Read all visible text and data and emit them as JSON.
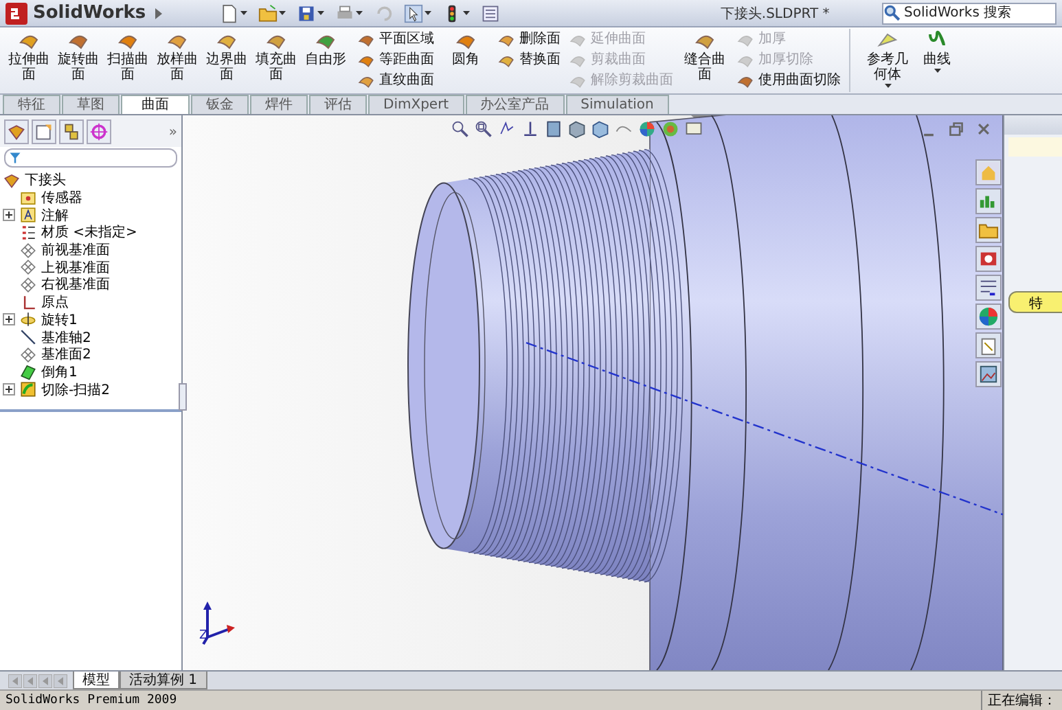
{
  "app": {
    "logo": "SolidWorks",
    "title": "下接头.SLDPRT *",
    "search": {
      "placeholder": "SolidWorks 搜索"
    }
  },
  "ribbon": [
    {
      "kind": "large",
      "items": [
        {
          "label": "拉伸曲面",
          "disabled": false
        },
        {
          "label": "旋转曲面",
          "disabled": false
        },
        {
          "label": "扫描曲面",
          "disabled": false
        },
        {
          "label": "放样曲面",
          "disabled": false
        },
        {
          "label": "边界曲面",
          "disabled": false
        },
        {
          "label": "填充曲面",
          "disabled": false
        },
        {
          "label": "自由形",
          "disabled": false
        }
      ]
    },
    {
      "kind": "column",
      "items": [
        {
          "label": "平面区域",
          "disabled": false
        },
        {
          "label": "等距曲面",
          "disabled": false
        },
        {
          "label": "直纹曲面",
          "disabled": false
        }
      ]
    },
    {
      "kind": "large",
      "items": [
        {
          "label": "圆角",
          "disabled": false
        }
      ]
    },
    {
      "kind": "column",
      "items": [
        {
          "label": "删除面",
          "disabled": false
        },
        {
          "label": "替换面",
          "disabled": false
        }
      ]
    },
    {
      "kind": "column",
      "items": [
        {
          "label": "延伸曲面",
          "disabled": true
        },
        {
          "label": "剪裁曲面",
          "disabled": true
        },
        {
          "label": "解除剪裁曲面",
          "disabled": true
        }
      ]
    },
    {
      "kind": "large",
      "items": [
        {
          "label": "缝合曲面",
          "disabled": false
        }
      ]
    },
    {
      "kind": "column",
      "items": [
        {
          "label": "加厚",
          "disabled": true
        },
        {
          "label": "加厚切除",
          "disabled": true
        },
        {
          "label": "使用曲面切除",
          "disabled": false
        }
      ]
    },
    {
      "kind": "large",
      "items": [
        {
          "label": "参考几何体",
          "disabled": false,
          "dropdown": true
        },
        {
          "label": "曲线",
          "disabled": false,
          "dropdown": true
        }
      ]
    }
  ],
  "tabs": [
    {
      "label": "特征",
      "selected": false
    },
    {
      "label": "草图",
      "selected": false
    },
    {
      "label": "曲面",
      "selected": true
    },
    {
      "label": "钣金",
      "selected": false
    },
    {
      "label": "焊件",
      "selected": false
    },
    {
      "label": "评估",
      "selected": false
    },
    {
      "label": "DimXpert",
      "selected": false
    },
    {
      "label": "办公室产品",
      "selected": false
    },
    {
      "label": "Simulation",
      "selected": false
    }
  ],
  "panel": {
    "more": "»"
  },
  "tree": {
    "label": "下接头",
    "kind": "part",
    "children": [
      {
        "label": "传感器",
        "kind": "sensor"
      },
      {
        "label": "注解",
        "kind": "annotation",
        "expanded": false
      },
      {
        "label": "材质 <未指定>",
        "kind": "material"
      },
      {
        "label": "前视基准面",
        "kind": "plane"
      },
      {
        "label": "上视基准面",
        "kind": "plane"
      },
      {
        "label": "右视基准面",
        "kind": "plane"
      },
      {
        "label": "原点",
        "kind": "origin"
      },
      {
        "label": "旋转1",
        "kind": "revolve",
        "expanded": false
      },
      {
        "label": "基准轴2",
        "kind": "axis"
      },
      {
        "label": "基准面2",
        "kind": "plane"
      },
      {
        "label": "倒角1",
        "kind": "chamfer"
      },
      {
        "label": "切除-扫描2",
        "kind": "cut",
        "expanded": false
      }
    ]
  },
  "viewport": {
    "triad_label": "Z"
  },
  "task_pane": {
    "button": "特"
  },
  "bottom_tabs": [
    {
      "label": "模型",
      "selected": true
    },
    {
      "label": "活动算例 1",
      "selected": false
    }
  ],
  "status_bar": {
    "left": "SolidWorks Premium 2009",
    "right": "正在编辑："
  }
}
